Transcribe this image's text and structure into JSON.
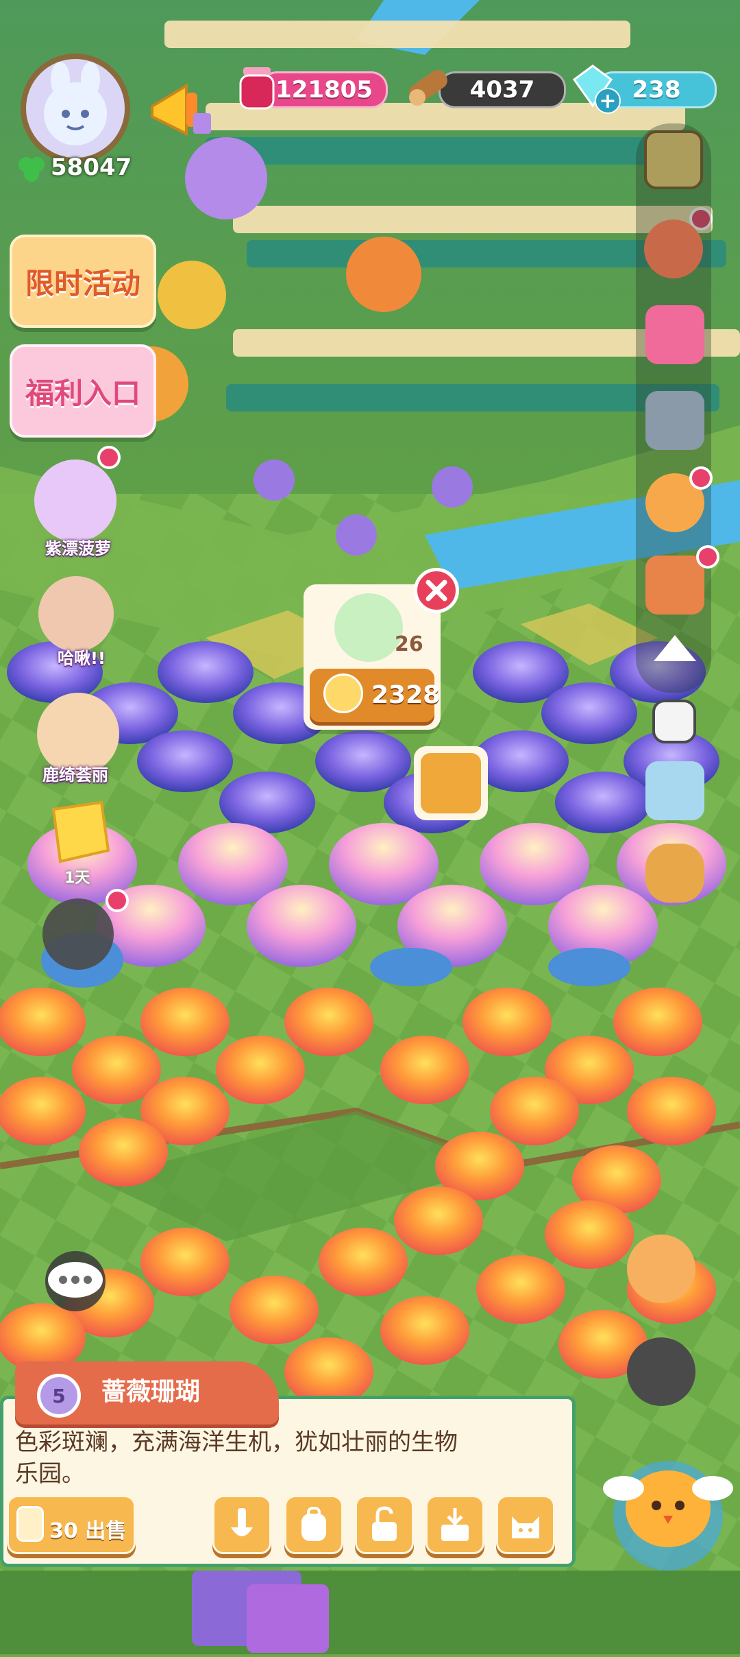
{
  "colors": {
    "grass": "#6fa84a",
    "panel_border": "#43a06a",
    "title_orange": "#e56c4a",
    "btn_yellow": "#f7b84f",
    "gem_pill": "#46c3d8",
    "jam_pill": "#e8488a",
    "wood_pill": "#3a3a3a"
  },
  "player": {
    "clover_count": "58047",
    "avatar_icon": "bunny-avatar-icon"
  },
  "resources": {
    "jam": "121805",
    "wood": "4037",
    "gems": "238"
  },
  "left_menu": {
    "event_label": "限时活动",
    "welfare_label": "福利入口",
    "friends": [
      {
        "name": "紫漂菠萝"
      },
      {
        "name": "哈啾!!"
      },
      {
        "name": "鹿绮荟丽"
      }
    ],
    "timer_label": "1天"
  },
  "popup": {
    "count": "26",
    "price": "2328"
  },
  "item_panel": {
    "level": "5",
    "name": "蔷薇珊瑚",
    "description_line1": "色彩斑斓，充满海洋生机，犹如壮丽的生物",
    "description_line2": "乐园。",
    "sell_label": "30 出售"
  }
}
